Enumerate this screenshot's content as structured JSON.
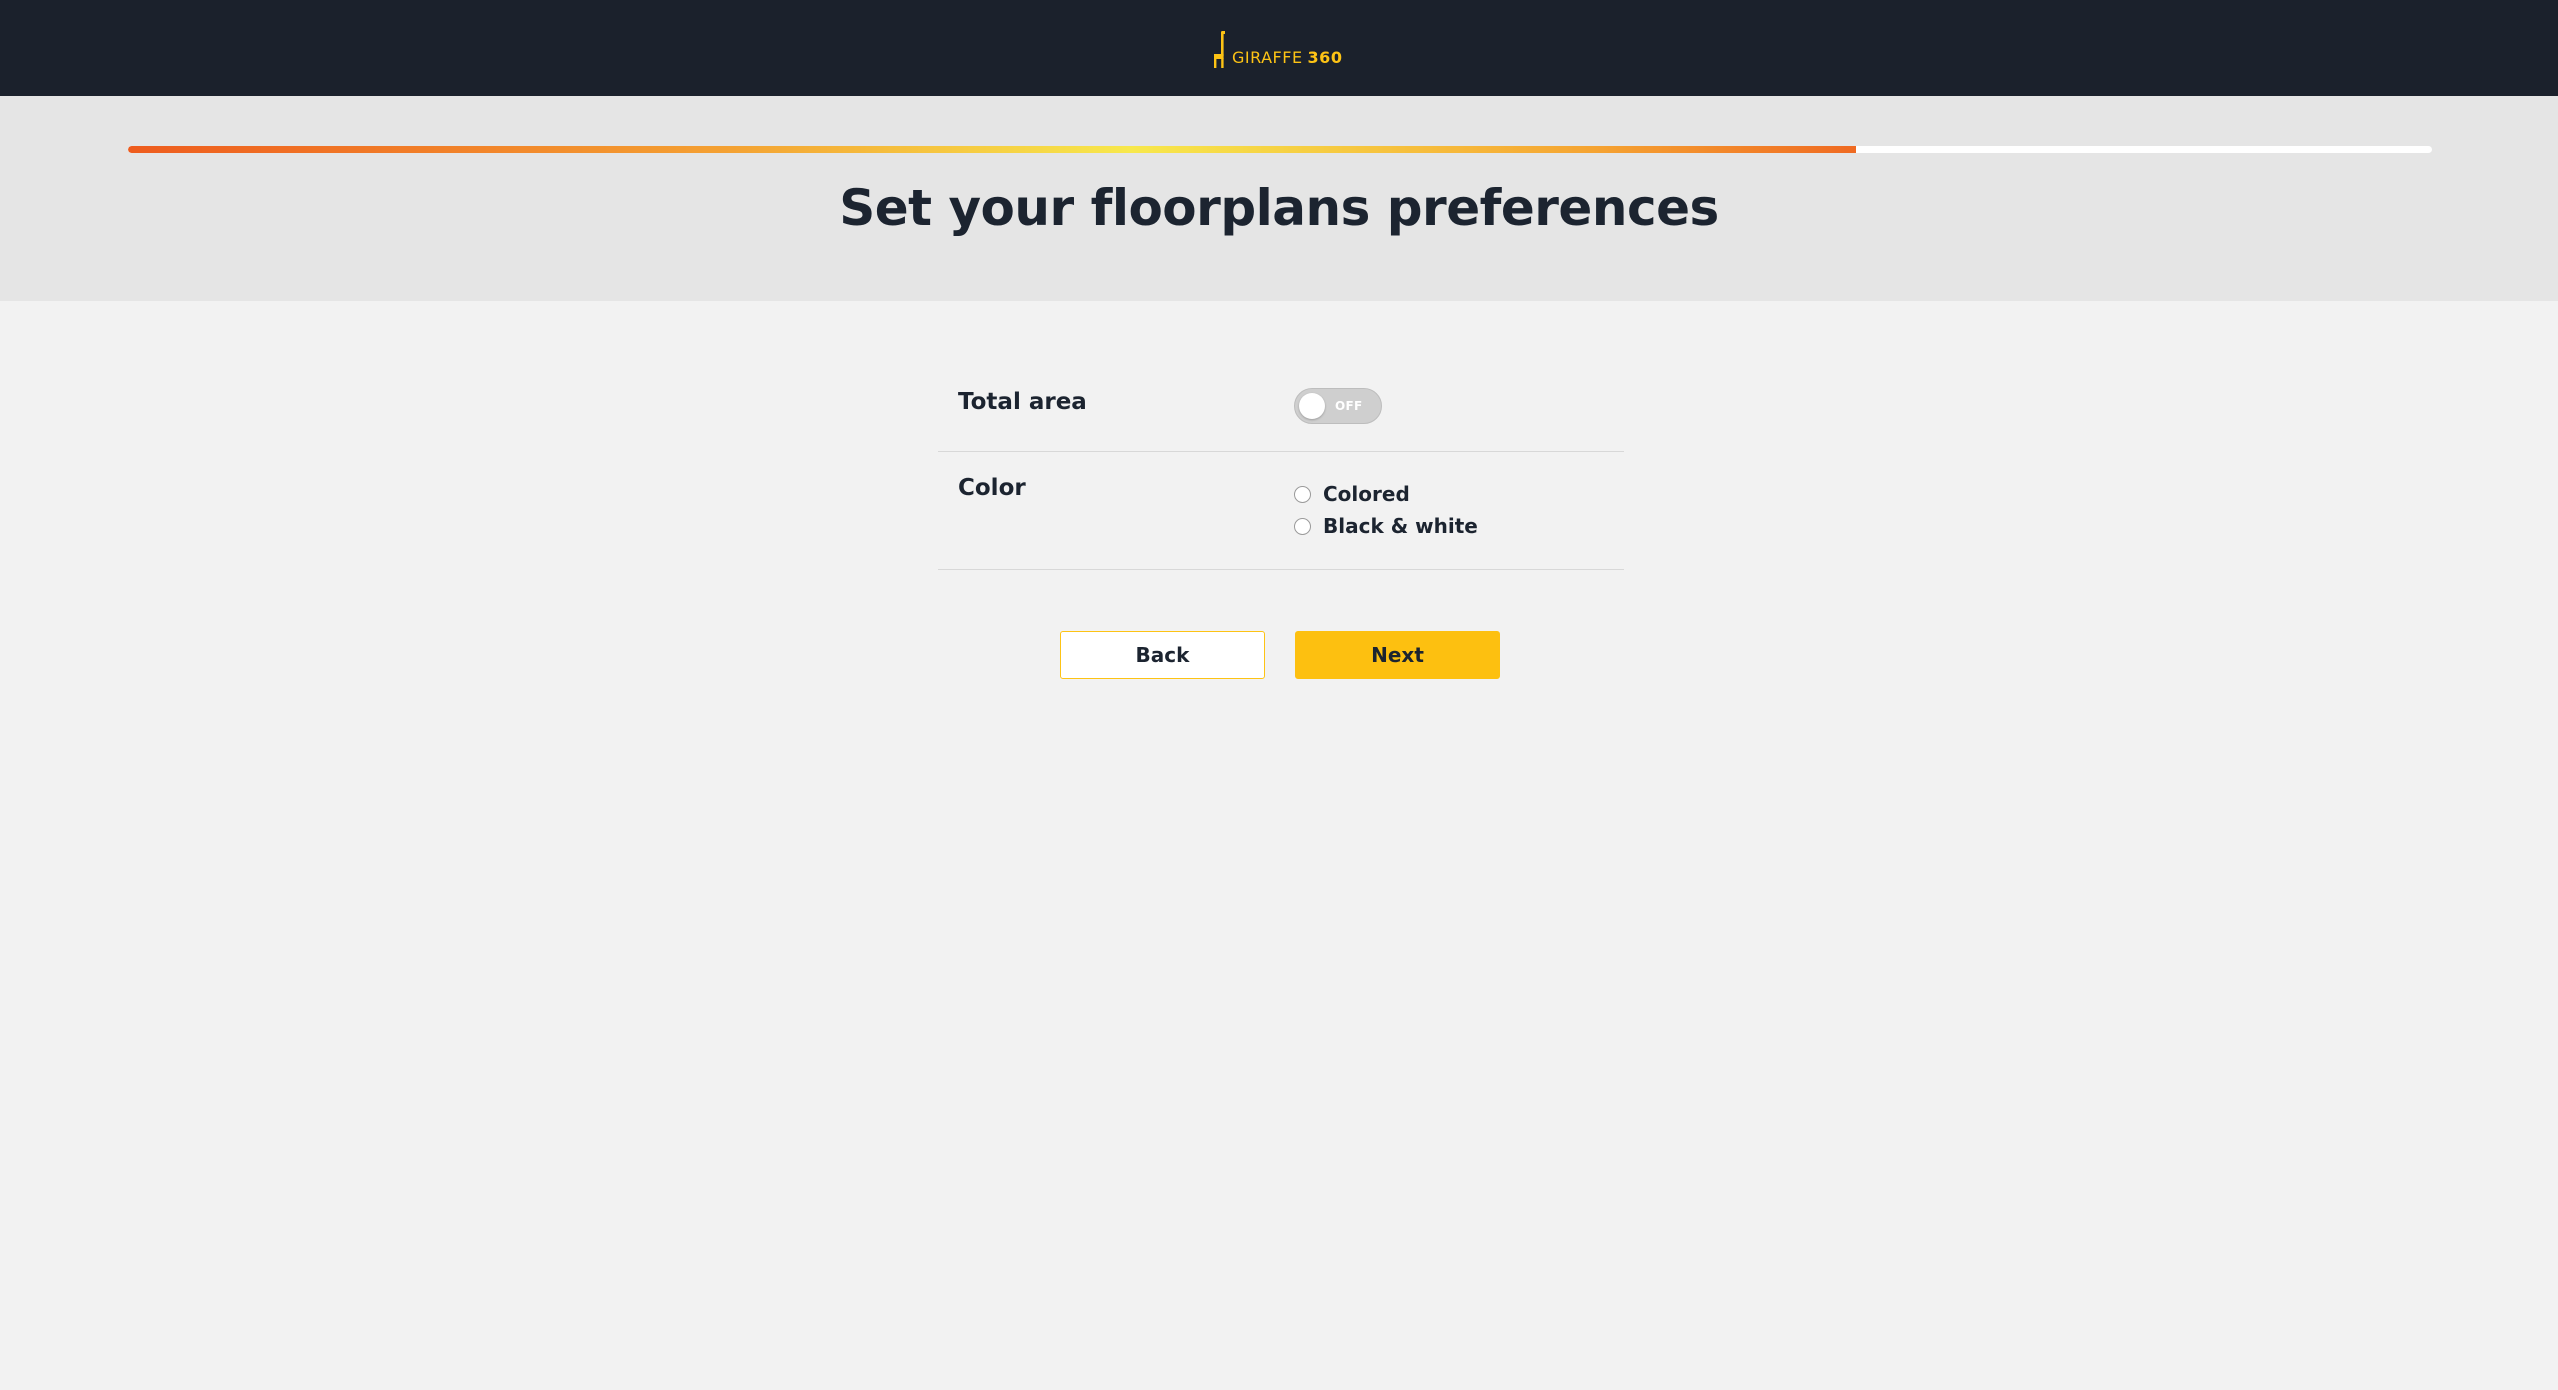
{
  "brand": {
    "name": "GIRAFFE",
    "number": "360",
    "accent_color": "#fdc315",
    "logo_icon": "giraffe-icon"
  },
  "progress": {
    "percent": 75,
    "gradient_colors": [
      "#ee5c1e",
      "#f7e84c",
      "#ef6a22"
    ]
  },
  "page": {
    "title": "Set your floorplans preferences"
  },
  "preferences": {
    "total_area": {
      "label": "Total area",
      "toggle_state": "OFF",
      "enabled": false
    },
    "color": {
      "label": "Color",
      "options": [
        {
          "label": "Colored",
          "selected": false
        },
        {
          "label": "Black & white",
          "selected": false
        }
      ]
    }
  },
  "actions": {
    "back_label": "Back",
    "next_label": "Next",
    "next_color": "#fdc010"
  }
}
